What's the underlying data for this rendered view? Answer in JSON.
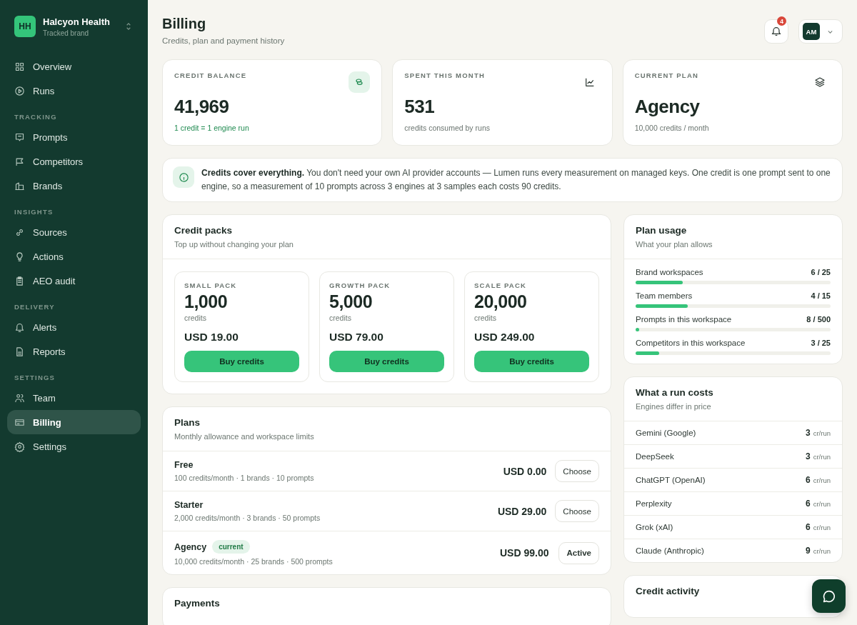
{
  "workspace": {
    "initials": "HH",
    "name": "Halcyon Health",
    "subtitle": "Tracked brand"
  },
  "nav": [
    {
      "items": [
        {
          "label": "Overview",
          "selected": false
        },
        {
          "label": "Runs",
          "selected": false
        }
      ]
    },
    {
      "heading": "TRACKING",
      "items": [
        {
          "label": "Prompts",
          "selected": false
        },
        {
          "label": "Competitors",
          "selected": false
        },
        {
          "label": "Brands",
          "selected": false
        }
      ]
    },
    {
      "heading": "INSIGHTS",
      "items": [
        {
          "label": "Sources",
          "selected": false
        },
        {
          "label": "Actions",
          "selected": false
        },
        {
          "label": "AEO audit",
          "selected": false
        }
      ]
    },
    {
      "heading": "DELIVERY",
      "items": [
        {
          "label": "Alerts",
          "selected": false
        },
        {
          "label": "Reports",
          "selected": false
        }
      ]
    },
    {
      "heading": "SETTINGS",
      "items": [
        {
          "label": "Team",
          "selected": false
        },
        {
          "label": "Billing",
          "selected": true
        },
        {
          "label": "Settings",
          "selected": false
        }
      ]
    }
  ],
  "page": {
    "title": "Billing",
    "subtitle": "Credits, plan and payment history"
  },
  "notifications": {
    "count": "4"
  },
  "user": {
    "initials": "AM"
  },
  "stats": [
    {
      "label": "CREDIT BALANCE",
      "value": "41,969",
      "note": "1 credit = 1 engine run",
      "accent": true
    },
    {
      "label": "SPENT THIS MONTH",
      "value": "531",
      "note": "credits consumed by runs",
      "accent": false
    },
    {
      "label": "CURRENT PLAN",
      "value": "Agency",
      "note": "10,000 credits / month",
      "accent": false
    }
  ],
  "info": "**Credits cover everything.** You don't need your own AI provider accounts — Lumen runs every measurement on managed keys. One credit is one prompt sent to one engine, so a measurement of 10 prompts across 3 engines at 3 samples each costs 90 credits.",
  "credit_packs": {
    "title": "Credit packs",
    "subtitle": "Top up without changing your plan",
    "packs": [
      {
        "label": "SMALL PACK",
        "amount": "1,000",
        "unit": "credits",
        "price": "USD 19.00",
        "button": "Buy credits"
      },
      {
        "label": "GROWTH PACK",
        "amount": "5,000",
        "unit": "credits",
        "price": "USD 79.00",
        "button": "Buy credits"
      },
      {
        "label": "SCALE PACK",
        "amount": "20,000",
        "unit": "credits",
        "price": "USD 249.00",
        "button": "Buy credits"
      }
    ]
  },
  "plans": {
    "title": "Plans",
    "subtitle": "Monthly allowance and workspace limits",
    "rows": [
      {
        "name": "Free",
        "details": "100 credits/month · 1 brands · 10 prompts",
        "price": "USD 0.00",
        "button": "Choose",
        "current": false
      },
      {
        "name": "Starter",
        "details": "2,000 credits/month · 3 brands · 50 prompts",
        "price": "USD 29.00",
        "button": "Choose",
        "current": false
      },
      {
        "name": "Agency",
        "badge": "current",
        "details": "10,000 credits/month · 25 brands · 500 prompts",
        "price": "USD 99.00",
        "button": "Active",
        "current": true
      }
    ]
  },
  "payments": {
    "title": "Payments"
  },
  "plan_usage": {
    "title": "Plan usage",
    "subtitle": "What your plan allows",
    "rows": [
      {
        "label": "Brand workspaces",
        "value": "6 / 25",
        "level": 0.24
      },
      {
        "label": "Team members",
        "value": "4 / 15",
        "level": 0.267
      },
      {
        "label": "Prompts in this workspace",
        "value": "8 / 500",
        "level": 0.016
      },
      {
        "label": "Competitors in this workspace",
        "value": "3 / 25",
        "level": 0.12
      }
    ]
  },
  "run_costs": {
    "title": "What a run costs",
    "subtitle": "Engines differ in price",
    "rows": [
      {
        "engine": "Gemini (Google)",
        "cost": "3",
        "unit": "cr/run"
      },
      {
        "engine": "DeepSeek",
        "cost": "3",
        "unit": "cr/run"
      },
      {
        "engine": "ChatGPT (OpenAI)",
        "cost": "6",
        "unit": "cr/run"
      },
      {
        "engine": "Perplexity",
        "cost": "6",
        "unit": "cr/run"
      },
      {
        "engine": "Grok (xAI)",
        "cost": "6",
        "unit": "cr/run"
      },
      {
        "engine": "Claude (Anthropic)",
        "cost": "9",
        "unit": "cr/run"
      }
    ]
  },
  "credit_activity": {
    "title": "Credit activity"
  }
}
